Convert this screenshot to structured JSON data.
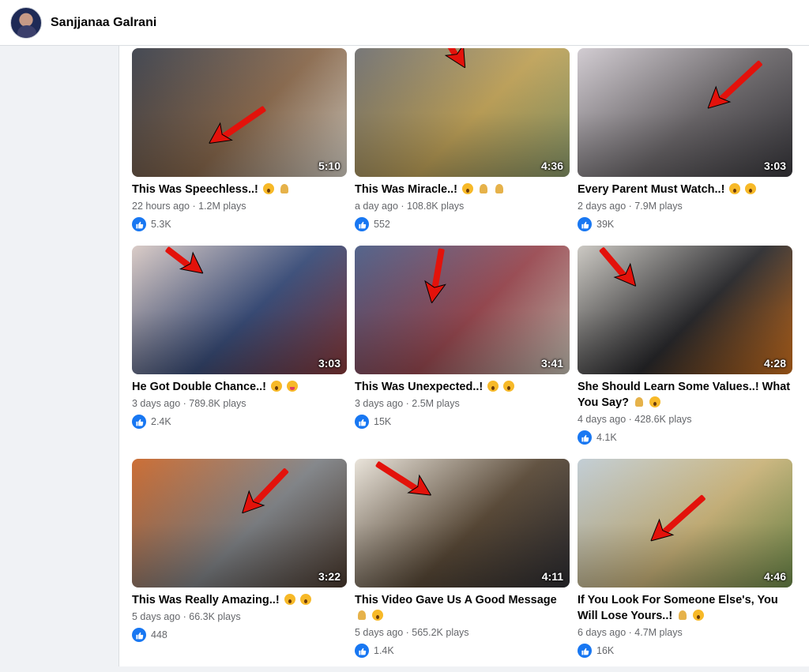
{
  "header": {
    "page_name": "Sanjjanaa Galrani",
    "avatar_icon": "profile-avatar"
  },
  "videos": [
    {
      "title": "This Was Speechless..!",
      "emojis": [
        "wow",
        "pray"
      ],
      "age": "22 hours ago",
      "plays": "1.2M plays",
      "likes": "5.3K",
      "duration": "5:10",
      "palette": [
        "#3a3f4a",
        "#8a6a4e",
        "#d9d3c8"
      ]
    },
    {
      "title": "This Was Miracle..!",
      "emojis": [
        "wow",
        "pray",
        "pray"
      ],
      "age": "a day ago",
      "plays": "108.8K plays",
      "likes": "552",
      "duration": "4:36",
      "palette": [
        "#6f6f70",
        "#c0a35a",
        "#8a9a6b"
      ]
    },
    {
      "title": "Every Parent Must Watch..!",
      "emojis": [
        "wow",
        "wow"
      ],
      "age": "2 days ago",
      "plays": "7.9M plays",
      "likes": "39K",
      "duration": "3:03",
      "palette": [
        "#cfc9cf",
        "#6e6a6d",
        "#3b3a3f"
      ]
    },
    {
      "title": "He Got Double Chance..!",
      "emojis": [
        "wow",
        "tongue"
      ],
      "age": "3 days ago",
      "plays": "789.8K plays",
      "likes": "2.4K",
      "duration": "3:03",
      "palette": [
        "#d8c9c4",
        "#3b4e7a",
        "#8b3a3a"
      ]
    },
    {
      "title": "This Was Unexpected..!",
      "emojis": [
        "wow",
        "wow"
      ],
      "age": "3 days ago",
      "plays": "2.5M plays",
      "likes": "15K",
      "duration": "3:41",
      "palette": [
        "#4a5c86",
        "#9a4a52",
        "#c7c2b5"
      ]
    },
    {
      "title": "She Should Learn Some Values..! What You Say?",
      "emojis": [
        "pray",
        "wow"
      ],
      "age": "4 days ago",
      "plays": "428.6K plays",
      "likes": "4.1K",
      "duration": "4:28",
      "palette": [
        "#c9c6c0",
        "#2b2b2e",
        "#d0721f"
      ]
    },
    {
      "title": "This Was Really Amazing..!",
      "emojis": [
        "wow",
        "wow"
      ],
      "age": "5 days ago",
      "plays": "66.3K plays",
      "likes": "448",
      "duration": "3:22",
      "palette": [
        "#c9662a",
        "#7f8286",
        "#4b3a2e"
      ]
    },
    {
      "title": "This Video Gave Us A Good Message",
      "emojis": [
        "pray",
        "wow"
      ],
      "age": "5 days ago",
      "plays": "565.2K plays",
      "likes": "1.4K",
      "duration": "4:11",
      "palette": [
        "#e8e2d8",
        "#5a4a38",
        "#2e2e33"
      ]
    },
    {
      "title": "If You Look For Someone Else's, You Will Lose Yours..!",
      "emojis": [
        "pray",
        "wow"
      ],
      "age": "6 days ago",
      "plays": "4.7M plays",
      "likes": "16K",
      "duration": "4:46",
      "palette": [
        "#bfcbd3",
        "#c9b37a",
        "#6d8a4a"
      ]
    }
  ],
  "colors": {
    "accent": "#1877f2",
    "arrow_red": "#e3120b",
    "meta_gray": "#65676b"
  }
}
